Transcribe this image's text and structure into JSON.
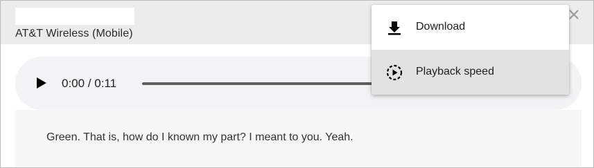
{
  "header": {
    "caller_label": "AT&T Wireless (Mobile)",
    "close_icon": "close-icon"
  },
  "player": {
    "time_display": "0:00 / 0:11",
    "play_icon": "play-icon"
  },
  "transcript": {
    "text": "Green. That is, how do I known my part? I meant to you. Yeah."
  },
  "menu": {
    "items": [
      {
        "label": "Download",
        "icon": "download-icon"
      },
      {
        "label": "Playback speed",
        "icon": "playback-speed-icon"
      }
    ]
  },
  "colors": {
    "header_bg": "#ececec",
    "player_bg": "#f1f3f4",
    "menu_hover": "#e2e2e2"
  }
}
